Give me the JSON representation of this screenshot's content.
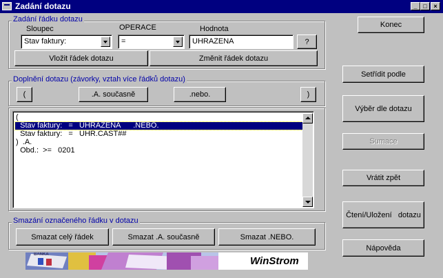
{
  "window": {
    "title": "Zadání dotazu"
  },
  "row_group": {
    "title": "Zadání řádku dotazu",
    "col_label": "Sloupec",
    "op_label": "OPERACE",
    "val_label": "Hodnota",
    "column_value": "Stav faktury:",
    "operator_value": "=",
    "value_text": "UHRAZENA",
    "help_label": "?",
    "insert_label": "Vložit řádek dotazu",
    "change_label": "Změnit řádek dotazu"
  },
  "supplement_group": {
    "title": "Doplnění dotazu (závorky, vztah více řádků dotazu)",
    "open_paren": "(",
    "and_label": ".A. současně",
    "or_label": ".nebo.",
    "close_paren": ")"
  },
  "query_lines": [
    "(",
    "  Stav faktury:   =   UHRAZENA      .NEBO.",
    "  Stav faktury:   =   UHR.CAST##",
    ")  .A.",
    "  Obd.:  >=   0201"
  ],
  "delete_group": {
    "title": "Smazání označeného řádku v dotazu",
    "delete_row": "Smazat celý řádek",
    "delete_and": "Smazat .A. současně",
    "delete_or": "Smazat .NEBO."
  },
  "side_buttons": {
    "end": "Konec",
    "sort": "Setřídit podle",
    "select": "Výběr dle dotazu",
    "sums": "Sumace",
    "undo": "Vrátit zpět",
    "read_save": "Čtení/Uložení   dotazu",
    "help": "Nápověda"
  },
  "banner": {
    "brand": "WinStrom",
    "sticker": "BANKA"
  }
}
